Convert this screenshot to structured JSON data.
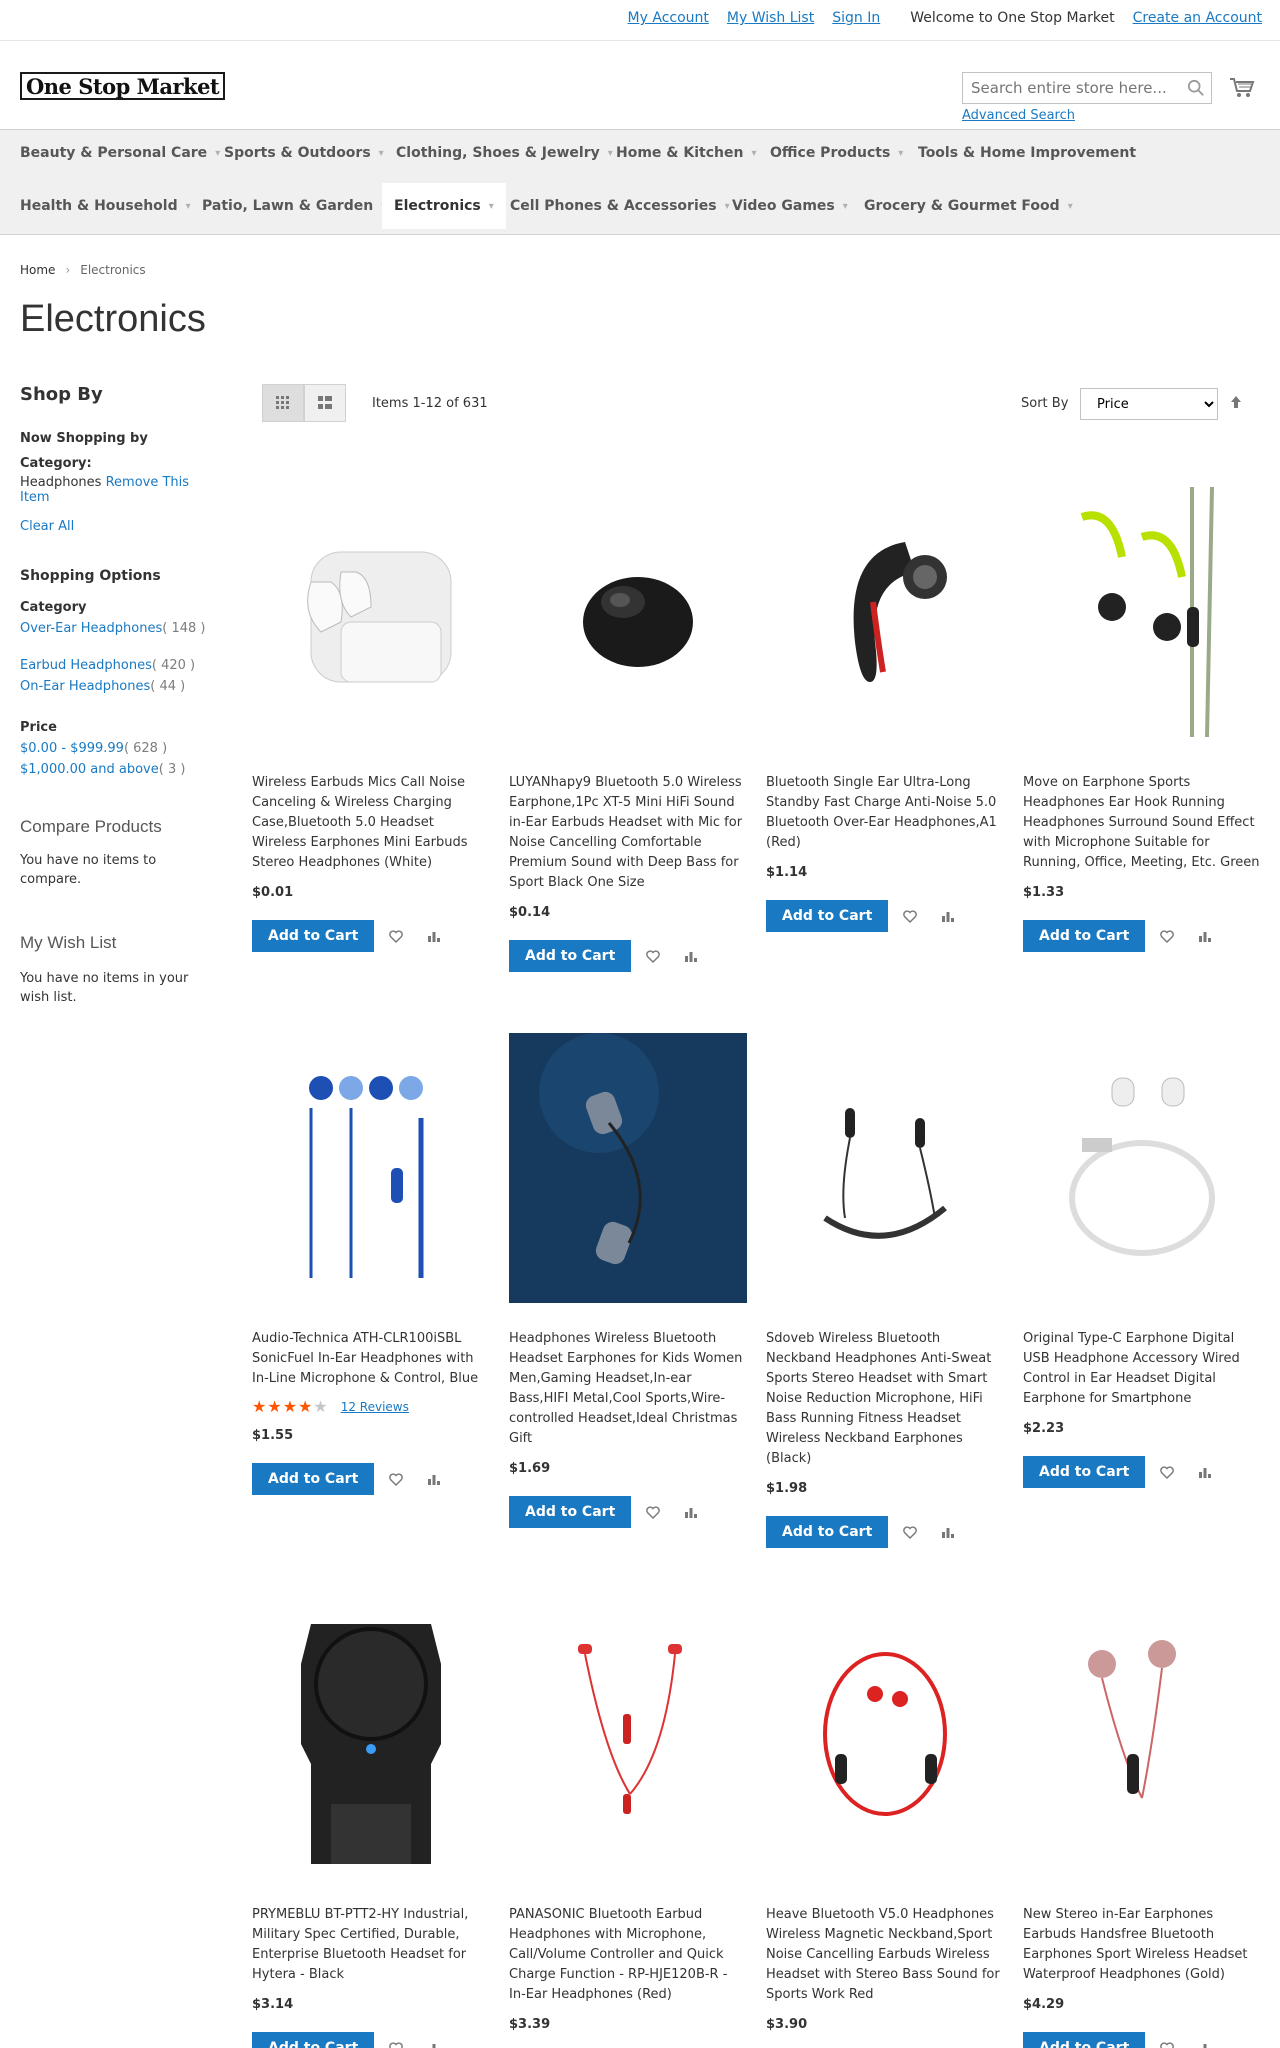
{
  "header": {
    "links": {
      "my_account": "My Account",
      "my_wish_list": "My Wish List",
      "sign_in": "Sign In",
      "welcome": "Welcome to One Stop Market",
      "create_account": "Create an Account"
    },
    "logo_text": "One Stop Market",
    "search_placeholder": "Search entire store here...",
    "advanced_search": "Advanced Search"
  },
  "nav": {
    "items": [
      "Beauty & Personal Care",
      "Sports & Outdoors",
      "Clothing, Shoes & Jewelry",
      "Home & Kitchen",
      "Office Products",
      "Tools & Home Improvement",
      "Health & Household",
      "Patio, Lawn & Garden",
      "Electronics",
      "Cell Phones & Accessories",
      "Video Games",
      "Grocery & Gourmet Food"
    ]
  },
  "breadcrumb": {
    "home": "Home",
    "current": "Electronics"
  },
  "page_title": "Electronics",
  "sidebar": {
    "shop_by": "Shop By",
    "now_shopping_by": "Now Shopping by",
    "filter_label": "Category:",
    "filter_value": "Headphones",
    "remove_item": "Remove This Item",
    "clear_all": "Clear All",
    "shopping_options": "Shopping Options",
    "category_title": "Category",
    "categories": [
      {
        "name": "Over-Ear Headphones",
        "count": "( 148 )"
      },
      {
        "name": "Earbud Headphones",
        "count": "( 420 )"
      },
      {
        "name": "On-Ear Headphones",
        "count": "( 44 )"
      }
    ],
    "price_title": "Price",
    "prices": [
      {
        "name": "$0.00 - $999.99",
        "count": "( 628 )"
      },
      {
        "name": "$1,000.00 and above",
        "count": "( 3 )"
      }
    ],
    "compare_title": "Compare Products",
    "compare_text": "You have no items to compare.",
    "wishlist_title": "My Wish List",
    "wishlist_text": "You have no items in your wish list."
  },
  "toolbar": {
    "items_count": "Items 1-12 of 631",
    "sort_label": "Sort By",
    "sort_value": "Price"
  },
  "products": [
    {
      "name": "Wireless Earbuds Mics Call Noise Canceling & Wireless Charging Case,Bluetooth 5.0 Headset Wireless Earphones Mini Earbuds Stereo Headphones (White)",
      "price": "$0.01"
    },
    {
      "name": "LUYANhapy9 Bluetooth 5.0 Wireless Earphone,1Pc XT-5 Mini HiFi Sound in-Ear Earbuds Headset with Mic for Noise Cancelling Comfortable Premium Sound with Deep Bass for Sport Black One Size",
      "price": "$0.14"
    },
    {
      "name": "Bluetooth Single Ear Ultra-Long Standby Fast Charge Anti-Noise 5.0 Bluetooth Over-Ear Headphones,A1 (Red)",
      "price": "$1.14"
    },
    {
      "name": "Move on Earphone Sports Headphones Ear Hook Running Headphones Surround Sound Effect with Microphone Suitable for Running, Office, Meeting, Etc. Green",
      "price": "$1.33"
    },
    {
      "name": "Audio-Technica ATH-CLR100iSBL SonicFuel In-Ear Headphones with In-Line Microphone & Control, Blue",
      "price": "$1.55",
      "rating": 4,
      "reviews": "12  Reviews"
    },
    {
      "name": "Headphones Wireless Bluetooth Headset Earphones for Kids Women Men,Gaming Headset,In-ear Bass,HIFI Metal,Cool Sports,Wire-controlled Headset,Ideal Christmas Gift",
      "price": "$1.69"
    },
    {
      "name": "Sdoveb Wireless Bluetooth Neckband Headphones Anti-Sweat Sports Stereo Headset with Smart Noise Reduction Microphone, HiFi Bass Running Fitness Headset Wireless Neckband Earphones (Black)",
      "price": "$1.98"
    },
    {
      "name": "Original Type-C Earphone Digital USB Headphone Accessory Wired Control in Ear Headset Digital Earphone for Smartphone",
      "price": "$2.23"
    },
    {
      "name": "PRYMEBLU BT-PTT2-HY Industrial, Military Spec Certified, Durable, Enterprise Bluetooth Headset for Hytera - Black",
      "price": "$3.14"
    },
    {
      "name": "PANASONIC Bluetooth Earbud Headphones with Microphone, Call/Volume Controller and Quick Charge Function - RP-HJE120B-R - In-Ear Headphones (Red)",
      "price": "$3.39"
    },
    {
      "name": "Heave Bluetooth V5.0 Headphones Wireless Magnetic Neckband,Sport Noise Cancelling Earbuds Wireless Headset with Stereo Bass Sound for Sports Work Red",
      "price": "$3.90"
    },
    {
      "name": "New Stereo in-Ear Earphones Earbuds Handsfree Bluetooth Earphones Sport Wireless Headset Waterproof Headphones (Gold)",
      "price": "$4.29"
    }
  ],
  "add_to_cart": "Add to Cart",
  "colors": {
    "accent": "#1979c3",
    "star": "#ff5501"
  }
}
